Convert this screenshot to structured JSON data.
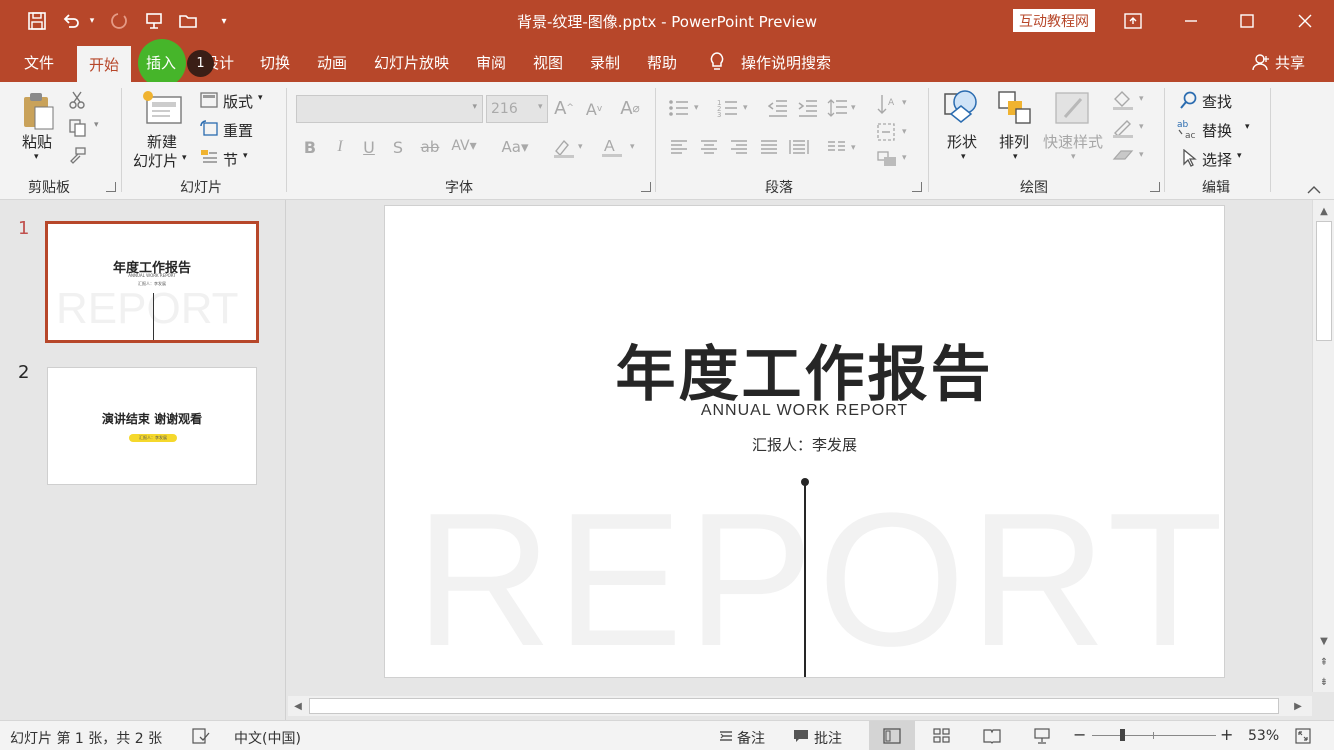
{
  "titlebar": {
    "title": "背景-纹理-图像.pptx  -  PowerPoint Preview",
    "badge": "互动教程网",
    "quick_access": [
      "save-icon",
      "undo-icon",
      "redo-icon",
      "present-icon",
      "open-icon",
      "customize-icon"
    ],
    "window_controls": [
      "ribbon-display-icon",
      "minimize-icon",
      "maximize-icon",
      "close-icon"
    ]
  },
  "tabs": {
    "file": "文件",
    "home": "开始",
    "insert": "插入",
    "design": "设计",
    "transitions": "切换",
    "animations": "动画",
    "slideshow": "幻灯片放映",
    "review": "审阅",
    "view": "视图",
    "record": "录制",
    "help": "帮助",
    "tellme": "操作说明搜索",
    "share": "共享",
    "step_marker": "1"
  },
  "ribbon": {
    "clipboard": {
      "paste": "粘贴",
      "group": "剪贴板"
    },
    "slides": {
      "new_line1": "新建",
      "new_line2": "幻灯片",
      "layout": "版式",
      "reset": "重置",
      "section": "节",
      "group": "幻灯片"
    },
    "font": {
      "size": "216",
      "group": "字体"
    },
    "paragraph": {
      "group": "段落"
    },
    "drawing": {
      "shapes": "形状",
      "arrange": "排列",
      "quickstyles": "快速样式",
      "group": "绘图"
    },
    "editing": {
      "find": "查找",
      "replace": "替换",
      "select": "选择",
      "group": "编辑"
    }
  },
  "thumbnails": [
    {
      "number": "1",
      "title": "年度工作报告",
      "sub": "ANNUAL WORK REPORT",
      "reporter": "汇报人：李发展",
      "bg": "REPORT"
    },
    {
      "number": "2",
      "title": "演讲结束 谢谢观看",
      "pill": "汇报人：李发展"
    }
  ],
  "slide": {
    "title": "年度工作报告",
    "subtitle": "ANNUAL WORK REPORT",
    "reporter": "汇报人：李发展",
    "bg_text": "REPORT"
  },
  "status": {
    "slide_info": "幻灯片 第 1 张，共 2 张",
    "language": "中文(中国)",
    "notes": "备注",
    "comments": "批注",
    "zoom": "53%",
    "zoom_level": 0.53
  },
  "colors": {
    "accent": "#b7472a",
    "pill": "#f5d82c"
  }
}
